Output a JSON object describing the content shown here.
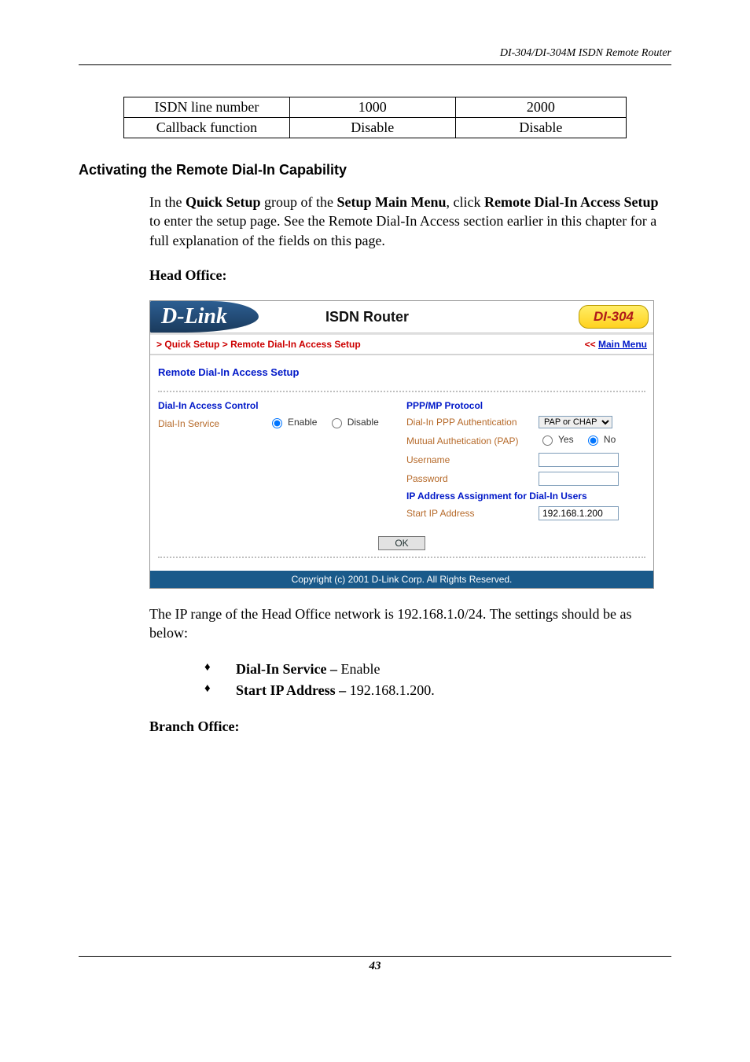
{
  "page": {
    "header_right": "DI-304/DI-304M ISDN Remote Router",
    "number": "43"
  },
  "table": {
    "r1c1": "ISDN line number",
    "r1c2": "1000",
    "r1c3": "2000",
    "r2c1": "Callback function",
    "r2c2": "Disable",
    "r2c3": "Disable"
  },
  "section_title": "Activating the Remote Dial-In Capability",
  "intro": {
    "text_a": "In the ",
    "bold_a": "Quick Setup",
    "text_b": " group of the ",
    "bold_b": "Setup Main Menu",
    "text_c": ", click ",
    "bold_c": "Remote Dial-In Access Setup",
    "text_d": " to enter the setup page. See the Remote Dial-In Access section earlier in this chapter for a full explanation of the fields on this page."
  },
  "head_office_label": "Head Office:",
  "ui": {
    "logo_text": "D-Link",
    "header_title": "ISDN Router",
    "model": "DI-304",
    "crumbs": {
      "sep1": ">",
      "a": "Quick Setup",
      "sep2": ">",
      "b": "Remote Dial-In Access Setup"
    },
    "main_menu": "Main Menu",
    "main_menu_prefix": "<<",
    "section_title": "Remote Dial-In Access Setup",
    "left": {
      "subtitle": "Dial-In Access Control",
      "dial_in_service_label": "Dial-In Service",
      "enable_label": "Enable",
      "disable_label": "Disable",
      "dial_in_service_value": "Enable"
    },
    "right": {
      "subtitle": "PPP/MP Protocol",
      "auth_label": "Dial-In PPP Authentication",
      "auth_value": "PAP or CHAP",
      "pap_label": "Mutual Authetication (PAP)",
      "pap_yes": "Yes",
      "pap_no": "No",
      "pap_value": "No",
      "username_label": "Username",
      "username_value": "",
      "password_label": "Password",
      "password_value": "",
      "ip_title": "IP Address Assignment for Dial-In Users",
      "start_ip_label": "Start IP Address",
      "start_ip_value": "192.168.1.200"
    },
    "ok_label": "OK",
    "footer": "Copyright (c) 2001 D-Link Corp. All Rights Reserved."
  },
  "ip_para": "The IP range of the Head Office network is 192.168.1.0/24. The settings should be as below:",
  "bullets": {
    "a_bold": "Dial-In Service – ",
    "a_text": "Enable",
    "b_bold": "Start IP Address – ",
    "b_text": "192.168.1.200."
  },
  "branch_label": "Branch Office:"
}
